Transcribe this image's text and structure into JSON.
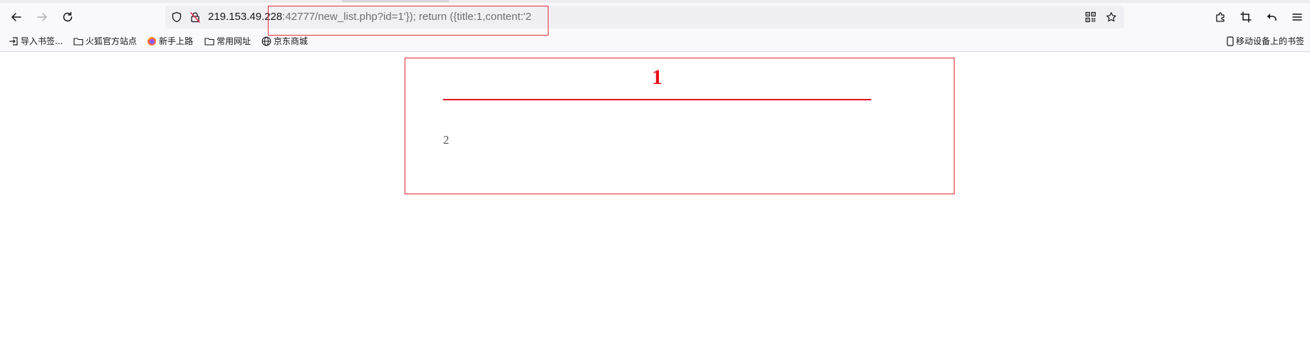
{
  "browser": {
    "url_host": "219.153.49.228",
    "url_rest": ":42777/new_list.php?id=1'}); return ({title:1,content:'2",
    "icons": {
      "back": "back-arrow-icon",
      "forward": "forward-arrow-icon",
      "reload": "reload-icon",
      "shield": "tracking-shield-icon",
      "insecure": "insecure-lock-icon",
      "qr": "qr-code-icon",
      "star": "bookmark-star-icon",
      "extensions": "extensions-icon",
      "screenshot": "crop-icon",
      "undo": "undo-icon",
      "menu": "hamburger-menu-icon"
    },
    "highlight_color": "#e0313b"
  },
  "bookmarks": {
    "items": [
      {
        "label": "导入书签...",
        "icon": "import-icon"
      },
      {
        "label": "火狐官方站点",
        "icon": "folder-icon"
      },
      {
        "label": "新手上路",
        "icon": "firefox-icon"
      },
      {
        "label": "常用网址",
        "icon": "folder-icon"
      },
      {
        "label": "京东商城",
        "icon": "globe-icon"
      }
    ],
    "mobile": {
      "label": "移动设备上的书签",
      "icon": "mobile-icon"
    }
  },
  "page": {
    "title": "1",
    "content": "2",
    "accent_color": "#e6121b"
  }
}
